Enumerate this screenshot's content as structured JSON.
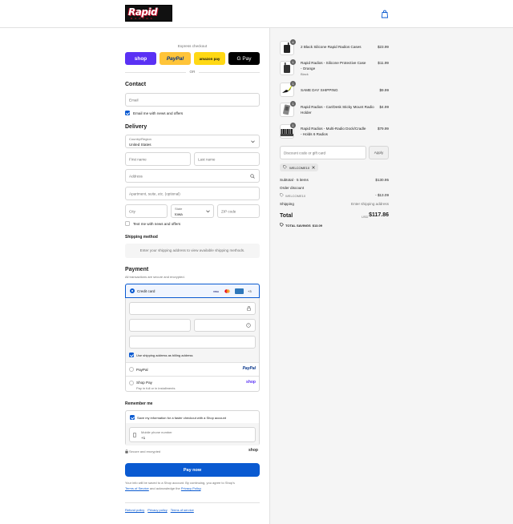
{
  "header": {
    "logo_text": "Rapid",
    "logo_sub": "RADIOS",
    "cart_icon": "shopping-bag-icon"
  },
  "express": {
    "title": "Express checkout",
    "shop_label": "shop",
    "paypal_label": "PayPal",
    "amazon_label": "amazon pay",
    "gpay_label": "G Pay",
    "or_label": "OR"
  },
  "contact": {
    "title": "Contact",
    "email_placeholder": "Email",
    "news_label": "Email me with news and offers"
  },
  "delivery": {
    "title": "Delivery",
    "country_label": "Country/Region",
    "country_value": "United States",
    "first_name": "First name",
    "last_name": "Last name",
    "address": "Address",
    "apartment": "Apartment, suite, etc. (optional)",
    "city": "City",
    "state_label": "State",
    "state_value": "Iowa",
    "zip": "ZIP code",
    "text_news": "Text me with news and offers"
  },
  "shipping": {
    "title": "Shipping method",
    "placeholder": "Enter your shipping address to view available shipping methods."
  },
  "payment": {
    "title": "Payment",
    "subtitle": "All transactions are secure and encrypted.",
    "credit_card": "Credit card",
    "brand_visa": "VISA",
    "brand_more": "+3",
    "billing_label": "Use shipping address as billing address",
    "paypal": "PayPal",
    "paypal_logo": "PayPal",
    "shop_pay": "Shop Pay",
    "shop_pay_sub": "Pay in full or in installments",
    "shop_logo": "shop"
  },
  "remember": {
    "title": "Remember me",
    "save_label": "Save my information for a faster checkout with a Shop account",
    "phone_label": "Mobile phone number",
    "phone_value": "+1",
    "secure": "Secure and encrypted",
    "shop_logo": "shop"
  },
  "pay_now": "Pay now",
  "legal": {
    "line1": "Your info will be saved to a Shop account. By continuing, you agree to Shop's",
    "terms": "Terms of Service",
    "and_ack": "and acknowledge the",
    "privacy": "Privacy Policy",
    "period": "."
  },
  "footer": {
    "refund": "Refund policy",
    "privacy": "Privacy policy",
    "terms": "Terms of service"
  },
  "order": {
    "items": [
      {
        "qty": "4",
        "name": "2 Black Silicone Rapid Radios Cases",
        "variant": "",
        "price": "$23.99"
      },
      {
        "qty": "1",
        "name": "Rapid Radios - Silicone Protective Case - Orange",
        "variant": "Black",
        "price": "$11.99"
      },
      {
        "qty": "1",
        "name": "SAME DAY SHIPPING",
        "variant": "",
        "price": "$9.99"
      },
      {
        "qty": "1",
        "name": "Rapid Radios - Car/Desk Sticky Mount Radio Holder",
        "variant": "",
        "price": "$4.99"
      },
      {
        "qty": "1",
        "name": "Rapid Radios - Multi-Radio Dock/Cradle - Holds 6 Radios",
        "variant": "",
        "price": "$79.99"
      }
    ],
    "discount_placeholder": "Discount code or gift card",
    "apply": "Apply",
    "code_tag": "WELCOME10",
    "subtotal_label": "Subtotal · 5 items",
    "subtotal_value": "$130.95",
    "order_discount": "Order discount",
    "discount_code": "WELCOME10",
    "discount_value": "- $13.09",
    "shipping_label": "Shipping",
    "shipping_value": "Enter shipping address",
    "total_label": "Total",
    "currency": "USD",
    "total_value": "$117.86",
    "savings_label": "TOTAL SAVINGS",
    "savings_value": "$13.09"
  }
}
